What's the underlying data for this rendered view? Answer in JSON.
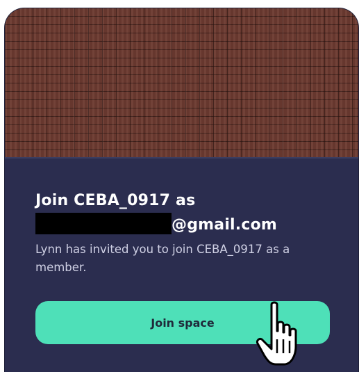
{
  "dialog": {
    "title_line1": "Join CEBA_0917 as",
    "email_suffix": "@gmail.com",
    "description": "Lynn has invited you to join CEBA_0917 as a member.",
    "join_button_label": "Join space"
  },
  "cursor": {
    "icon": "hand-pointer-icon"
  },
  "colors": {
    "panel": "#2b2d4f",
    "accent": "#4ee0b8",
    "banner": "#6c3a30"
  }
}
